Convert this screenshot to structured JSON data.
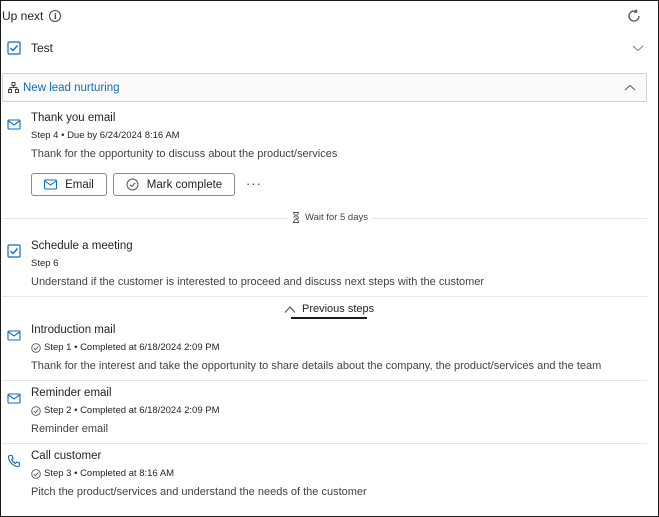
{
  "header": {
    "title": "Up next",
    "info_icon": "info-icon",
    "refresh_icon": "refresh-icon"
  },
  "test_item": {
    "label": "Test",
    "icon": "checkbox-task-icon"
  },
  "sequence": {
    "name": "New lead nurturing",
    "accent": "#0f6cbd"
  },
  "current_step": {
    "title": "Thank you email",
    "meta": "Step 4 • Due by 6/24/2024 8:16 AM",
    "description": "Thank for the opportunity to discuss about  the product/services",
    "email_button": "Email",
    "complete_button": "Mark complete",
    "more": "···",
    "icon": "mail-icon"
  },
  "wait": {
    "label": "Wait for 5 days",
    "icon": "hourglass-icon"
  },
  "next_step": {
    "title": "Schedule a meeting",
    "meta": "Step 6",
    "description": "Understand if the customer is interested to proceed and discuss next steps with the customer",
    "icon": "checkbox-task-icon"
  },
  "previous_toggle": {
    "label": "Previous steps",
    "icon": "chevron-up-icon"
  },
  "previous_steps": [
    {
      "title": "Introduction mail",
      "meta": "Step 1 • Completed at 6/18/2024 2:09 PM",
      "description": "Thank for the interest and take the opportunity to share details about the company, the product/services and the team",
      "icon": "mail-icon"
    },
    {
      "title": "Reminder email",
      "meta": "Step 2 • Completed at 6/18/2024 2:09 PM",
      "description": "Reminder email",
      "icon": "mail-icon"
    },
    {
      "title": "Call customer",
      "meta": "Step 3 • Completed at 8:16 AM",
      "description": "Pitch the product/services and understand the needs of the customer",
      "icon": "phone-icon"
    }
  ]
}
